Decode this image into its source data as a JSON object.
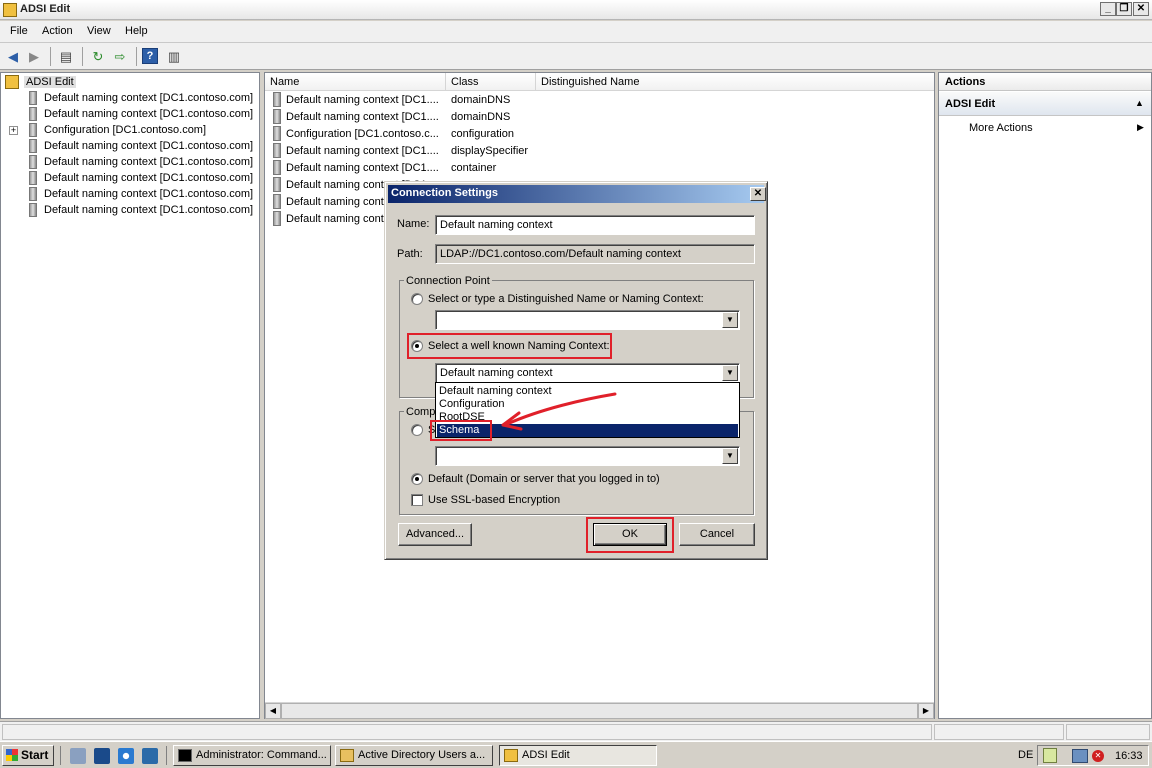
{
  "window": {
    "title": "ADSI Edit",
    "min_glyph": "_",
    "max_glyph": "❐",
    "close_glyph": "✕"
  },
  "menu": [
    "File",
    "Action",
    "View",
    "Help"
  ],
  "tree": {
    "root": "ADSI Edit",
    "items": [
      "Default naming context [DC1.contoso.com]",
      "Default naming context [DC1.contoso.com]",
      "Configuration [DC1.contoso.com]",
      "Default naming context [DC1.contoso.com]",
      "Default naming context [DC1.contoso.com]",
      "Default naming context [DC1.contoso.com]",
      "Default naming context [DC1.contoso.com]",
      "Default naming context [DC1.contoso.com]"
    ],
    "expander_glyph": "+"
  },
  "list": {
    "columns": [
      "Name",
      "Class",
      "Distinguished Name"
    ],
    "rows": [
      {
        "name": "Default naming context [DC1....",
        "class": "domainDNS"
      },
      {
        "name": "Default naming context [DC1....",
        "class": "domainDNS"
      },
      {
        "name": "Configuration [DC1.contoso.c...",
        "class": "configuration"
      },
      {
        "name": "Default naming context [DC1....",
        "class": "displaySpecifier"
      },
      {
        "name": "Default naming context [DC1....",
        "class": "container"
      },
      {
        "name": "Default naming context [DC1....",
        "class": ""
      },
      {
        "name": "Default naming context [DC1....",
        "class": ""
      },
      {
        "name": "Default naming context [DC1....",
        "class": ""
      }
    ]
  },
  "actions": {
    "header": "Actions",
    "section": "ADSI Edit",
    "more": "More Actions"
  },
  "dialog": {
    "title": "Connection Settings",
    "name_label": "Name:",
    "name_value": "Default naming context",
    "path_label": "Path:",
    "path_value": "LDAP://DC1.contoso.com/Default naming context",
    "connection_point": "Connection Point",
    "radio_dn": "Select or type a Distinguished Name or Naming Context:",
    "radio_wellknown": "Select a well known Naming Context:",
    "wellknown_value": "Default naming context",
    "dropdown_options": [
      "Default naming context",
      "Configuration",
      "RootDSE",
      "Schema"
    ],
    "dropdown_selected": "Schema",
    "computer_group_partial": "Comp",
    "radio_computer_partial": "S",
    "radio_default": "Default (Domain or server that you logged in to)",
    "ssl_label": "Use SSL-based Encryption",
    "advanced_button": "Advanced...",
    "ok_button": "OK",
    "cancel_button": "Cancel"
  },
  "taskbar": {
    "start": "Start",
    "tasks": [
      "Administrator: Command...",
      "Active Directory Users a...",
      "ADSI Edit"
    ],
    "language": "DE",
    "clock": "16:33"
  },
  "colors": {
    "highlight": "#e0202a",
    "selection": "#0a246a"
  }
}
